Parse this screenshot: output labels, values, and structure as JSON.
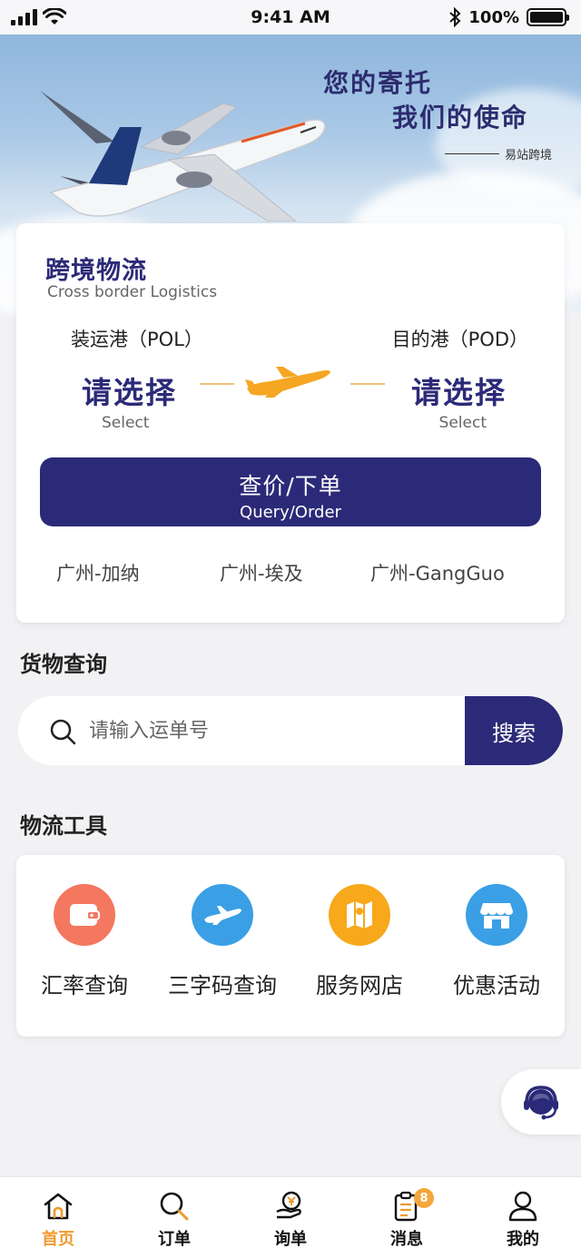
{
  "status_bar": {
    "time": "9:41 AM",
    "battery": "100%",
    "battery_level": 1.0
  },
  "banner": {
    "line1": "您的寄托",
    "line2": "我们的使命",
    "signature": "易站跨境"
  },
  "logistics": {
    "title": "跨境物流",
    "subtitle": "Cross border Logistics",
    "pol_label": "装运港（POL）",
    "pod_label": "目的港（POD）",
    "pol_value": "请选择",
    "pod_value": "请选择",
    "pol_value_en": "Select",
    "pod_value_en": "Select",
    "query_button": "查价/下单",
    "query_button_en": "Query/Order",
    "routes": [
      "广州-加纳",
      "广州-埃及",
      "广州-GangGuo"
    ]
  },
  "cargo": {
    "title": "货物查询",
    "placeholder": "请输入运单号",
    "search_button": "搜索"
  },
  "tools": {
    "title": "物流工具",
    "items": [
      {
        "label": "汇率查询",
        "icon": "wallet-icon",
        "color": "#f4775f"
      },
      {
        "label": "三字码查询",
        "icon": "airplane-icon",
        "color": "#3a9fe5"
      },
      {
        "label": "服务网店",
        "icon": "map-icon",
        "color": "#f7a81b"
      },
      {
        "label": "优惠活动",
        "icon": "store-icon",
        "color": "#3a9fe5"
      }
    ]
  },
  "nav": {
    "items": [
      {
        "label": "首页",
        "icon": "home-icon",
        "active": true
      },
      {
        "label": "订单",
        "icon": "search-icon"
      },
      {
        "label": "询单",
        "icon": "yen-hand-icon"
      },
      {
        "label": "消息",
        "icon": "clipboard-icon",
        "badge": "8"
      },
      {
        "label": "我的",
        "icon": "user-icon"
      }
    ]
  },
  "colors": {
    "brand": "#2b2a78",
    "accent": "#f09a2e"
  }
}
